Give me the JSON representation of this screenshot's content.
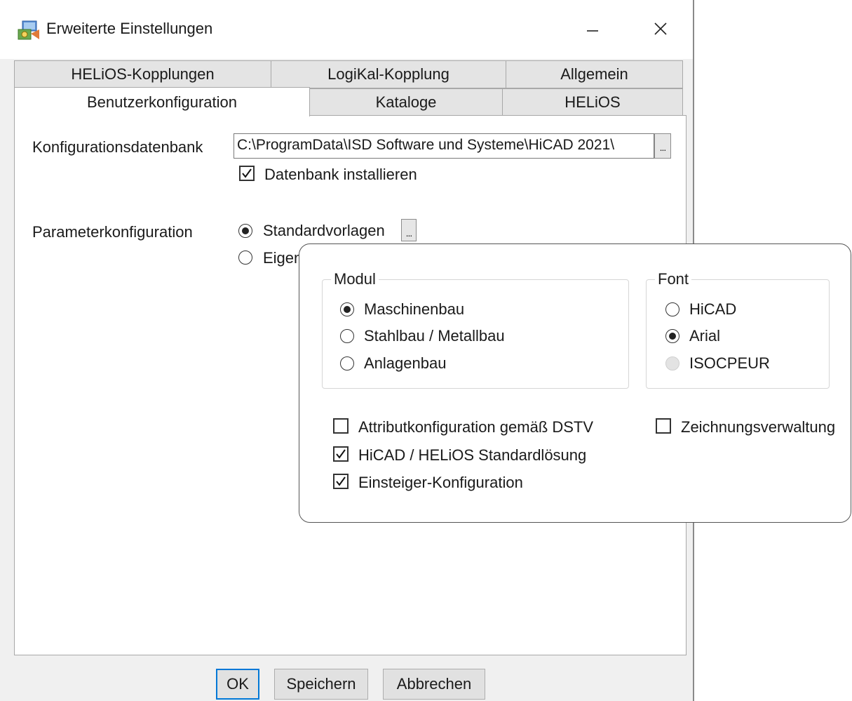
{
  "window": {
    "title": "Erweiterte Einstellungen",
    "minimize_glyph": "—",
    "maximize_glyph": "☐",
    "close_glyph": "✕"
  },
  "tabs": {
    "row_back": [
      "HELiOS-Kopplungen",
      "LogiKal-Kopplung",
      "Allgemein"
    ],
    "row_front": [
      "Benutzerkonfiguration",
      "Kataloge",
      "HELiOS"
    ],
    "active": "Benutzerkonfiguration"
  },
  "config_db": {
    "label": "Konfigurationsdatenbank",
    "path": "C:\\ProgramData\\ISD Software und Systeme\\HiCAD 2021\\",
    "browse_label": "...",
    "install_checkbox": {
      "label": "Datenbank installieren",
      "checked": true
    }
  },
  "param_config": {
    "label": "Parameterkonfiguration",
    "options": [
      {
        "label": "Standardvorlagen",
        "selected": true
      },
      {
        "label": "Eigen",
        "selected": false
      }
    ],
    "browse_label": "..."
  },
  "popup": {
    "modul_group": {
      "title": "Modul",
      "options": [
        {
          "label": "Maschinenbau",
          "selected": true
        },
        {
          "label": "Stahlbau / Metallbau",
          "selected": false
        },
        {
          "label": "Anlagenbau",
          "selected": false
        }
      ]
    },
    "font_group": {
      "title": "Font",
      "options": [
        {
          "label": "HiCAD",
          "selected": false,
          "enabled": true
        },
        {
          "label": "Arial",
          "selected": true,
          "enabled": true
        },
        {
          "label": "ISOCPEUR",
          "selected": false,
          "enabled": false
        }
      ]
    },
    "checkboxes": [
      {
        "label": "Attributkonfiguration gemäß DSTV",
        "checked": false
      },
      {
        "label": "HiCAD / HELiOS Standardlösung",
        "checked": true
      },
      {
        "label": "Einsteiger-Konfiguration",
        "checked": true
      }
    ],
    "side_checkbox": {
      "label": "Zeichnungsverwaltung",
      "checked": false
    }
  },
  "buttons": {
    "ok": "OK",
    "save": "Speichern",
    "cancel": "Abbrechen"
  },
  "colors": {
    "accent": "#0078d7",
    "panel": "#ffffff",
    "chrome": "#f0f0f0"
  }
}
